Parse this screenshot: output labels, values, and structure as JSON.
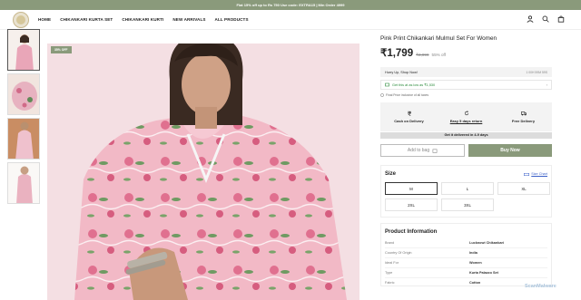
{
  "promo": {
    "text": "Flat 15% off up to Rs 750 Use code: EXTRA15 | Min Order 4999"
  },
  "nav": {
    "items": [
      "HOME",
      "CHIKANKARI KURTA SET",
      "CHIKANKARI KURTI",
      "NEW ARRIVALS",
      "ALL PRODUCTS"
    ]
  },
  "product": {
    "sale_badge": "35% OFF",
    "title": "Pink Print Chikankari Mulmul Set For Women",
    "price": "₹1,799",
    "mrp": "₹3,999",
    "discount": "55% off",
    "hurry": "Hurry Up, Shop Now!",
    "timer": "1 00H 59M 59S",
    "offer": "Get this at as low as ₹1,530",
    "tax_note": "Final Price inclusive of all taxes",
    "features": [
      "Cash on Delivery",
      "Easy 5 days return",
      "Free Delivery"
    ],
    "delivery": "Get it delivered in 4-9 days",
    "add_to_bag": "Add to bag",
    "buy_now": "Buy Now"
  },
  "size": {
    "title": "Size",
    "chart_link": "Size Chart",
    "options": [
      "M",
      "L",
      "XL",
      "2XL",
      "3XL"
    ],
    "selected": "M"
  },
  "product_info": {
    "title": "Product Information",
    "rows": [
      {
        "k": "Brand",
        "v": "Lucknowi Chikankari"
      },
      {
        "k": "Country Of Origin",
        "v": "India"
      },
      {
        "k": "Ideal For",
        "v": "Women"
      },
      {
        "k": "Type",
        "v": "Kurta Palazzo Set"
      },
      {
        "k": "Fabric",
        "v": "Cotton"
      }
    ]
  },
  "watermark": "ScanMalware",
  "colors": {
    "accent": "#8a9a7b",
    "link": "#3a5fc8",
    "offer": "#2a8a3a"
  }
}
